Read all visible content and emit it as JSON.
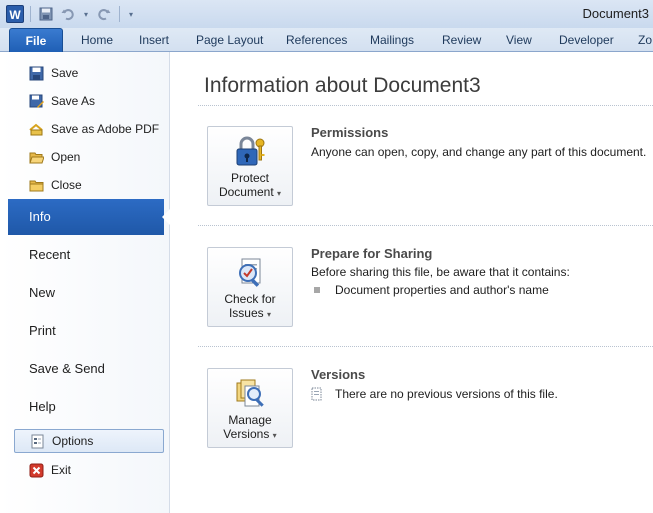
{
  "window": {
    "title": "Document3",
    "app_icon_letter": "W"
  },
  "quick_access": [
    {
      "name": "save-icon"
    },
    {
      "name": "undo-icon"
    },
    {
      "name": "redo-icon"
    },
    {
      "name": "customize-qat-icon"
    }
  ],
  "ribbon": {
    "file_tab": "File",
    "tabs": [
      "Home",
      "Insert",
      "Page Layout",
      "References",
      "Mailings",
      "Review",
      "View",
      "Developer",
      "Zo"
    ]
  },
  "nav": {
    "commands_top": [
      {
        "label": "Save",
        "icon": "save-icon"
      },
      {
        "label": "Save As",
        "icon": "save-as-icon"
      },
      {
        "label": "Save as Adobe PDF",
        "icon": "adobe-pdf-icon"
      },
      {
        "label": "Open",
        "icon": "open-folder-icon"
      },
      {
        "label": "Close",
        "icon": "close-folder-icon"
      }
    ],
    "tabs": [
      "Info",
      "Recent",
      "New",
      "Print",
      "Save & Send",
      "Help"
    ],
    "active_tab": "Info",
    "options": "Options",
    "exit": "Exit"
  },
  "info": {
    "heading": "Information about Document3",
    "permissions": {
      "button_line1": "Protect",
      "button_line2": "Document",
      "title": "Permissions",
      "text": "Anyone can open, copy, and change any part of this document."
    },
    "sharing": {
      "button_line1": "Check for",
      "button_line2": "Issues",
      "title": "Prepare for Sharing",
      "text": "Before sharing this file, be aware that it contains:",
      "bullet": "Document properties and author's name"
    },
    "versions": {
      "button_line1": "Manage",
      "button_line2": "Versions",
      "title": "Versions",
      "text": "There are no previous versions of this file."
    }
  },
  "colors": {
    "accent": "#1f58a8",
    "ribbon_bg": "#d3e0f0"
  }
}
